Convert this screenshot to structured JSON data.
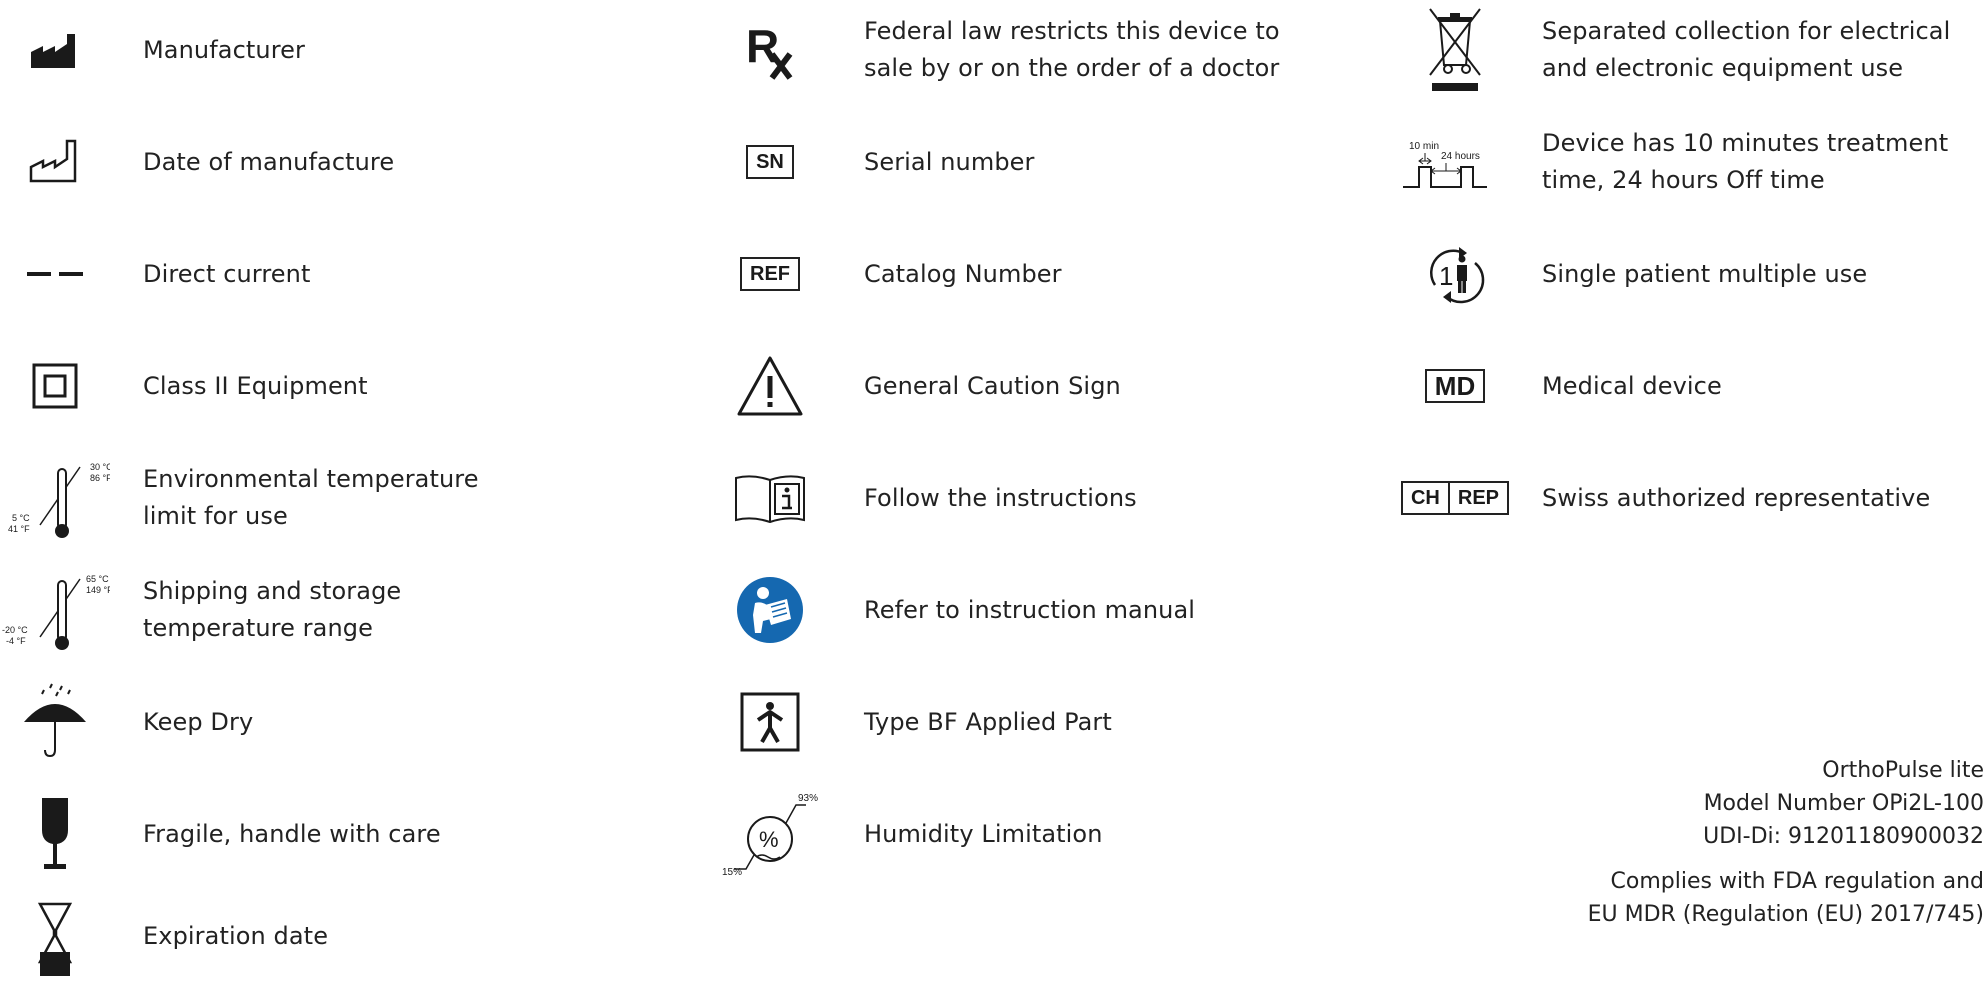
{
  "col1": [
    {
      "label": "Manufacturer",
      "icon": "manufacturer-icon"
    },
    {
      "label": "Date of manufacture",
      "icon": "date-of-manufacture-icon"
    },
    {
      "label": "Direct current",
      "icon": "direct-current-icon"
    },
    {
      "label": "Class II Equipment",
      "icon": "class-ii-icon"
    },
    {
      "label_line1": "Environmental temperature",
      "label_line2": "limit for use",
      "icon": "temperature-limit-icon",
      "temp_high_c": "30 °C",
      "temp_high_f": "86 °F",
      "temp_low_c": "5 °C",
      "temp_low_f": "41 °F"
    },
    {
      "label_line1": "Shipping and storage",
      "label_line2": "temperature range",
      "icon": "storage-temperature-icon",
      "temp_high_c": "65 °C",
      "temp_high_f": "149 °F",
      "temp_low_c": "-20 °C",
      "temp_low_f": "-4 °F"
    },
    {
      "label": "Keep Dry",
      "icon": "umbrella-icon"
    },
    {
      "label": "Fragile, handle with care",
      "icon": "fragile-glass-icon"
    },
    {
      "label": "Expiration date",
      "icon": "hourglass-icon"
    }
  ],
  "col2": [
    {
      "label_line1": "Federal law restricts this device to",
      "label_line2": "sale by or on the order of a doctor",
      "icon": "rx-icon",
      "symbol": "R"
    },
    {
      "label": "Serial number",
      "icon": "sn-icon",
      "symbol": "SN"
    },
    {
      "label": "Catalog Number",
      "icon": "ref-icon",
      "symbol": "REF"
    },
    {
      "label": "General Caution Sign",
      "icon": "caution-icon"
    },
    {
      "label": "Follow the instructions",
      "icon": "instructions-book-icon"
    },
    {
      "label": "Refer to instruction manual",
      "icon": "instruction-manual-icon"
    },
    {
      "label": "Type BF Applied Part",
      "icon": "type-bf-icon"
    },
    {
      "label": "Humidity Limitation",
      "icon": "humidity-icon",
      "high": "93%",
      "low": "15%"
    }
  ],
  "col3": [
    {
      "label_line1": "Separated collection for electrical",
      "label_line2": "and electronic equipment use",
      "icon": "weee-bin-icon"
    },
    {
      "label_line1": "Device has 10 minutes treatment",
      "label_line2": "time, 24 hours Off time",
      "icon": "treatment-timing-icon",
      "on_time": "10 min",
      "off_time": "24 hours"
    },
    {
      "label": "Single patient multiple use",
      "icon": "single-patient-icon",
      "symbol": "1"
    },
    {
      "label": "Medical device",
      "icon": "md-icon",
      "symbol": "MD"
    },
    {
      "label": "Swiss authorized representative",
      "icon": "ch-rep-icon",
      "symbol_a": "CH",
      "symbol_b": "REP"
    }
  ],
  "info": {
    "product": "OrthoPulse lite",
    "model": "Model Number OPi2L-100",
    "udi": "UDI-Di: 91201180900032",
    "compliance1": "Complies with FDA regulation and",
    "compliance2": "EU MDR (Regulation (EU) 2017/745)"
  }
}
